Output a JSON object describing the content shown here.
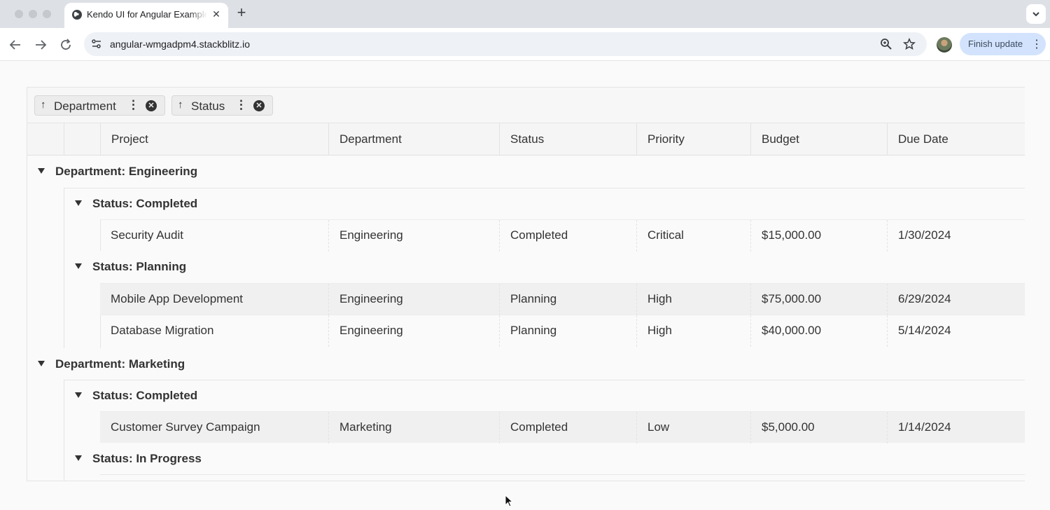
{
  "browser": {
    "tab_title": "Kendo UI for Angular Example",
    "tab_close": "✕",
    "new_tab": "+",
    "url": "angular-wmgadpm4.stackblitz.io",
    "update_button": "Finish update",
    "icons": [
      "globe-icon",
      "back-icon",
      "forward-icon",
      "reload-icon",
      "site-info-icon",
      "zoom-icon",
      "star-icon",
      "kebab-icon"
    ]
  },
  "grid": {
    "group_chips": [
      {
        "label": "Department",
        "arrow": "↑",
        "more": "⋮",
        "remove": "✕"
      },
      {
        "label": "Status",
        "arrow": "↑",
        "more": "⋮",
        "remove": "✕"
      }
    ],
    "columns": [
      "Project",
      "Department",
      "Status",
      "Priority",
      "Budget",
      "Due Date"
    ],
    "groups": [
      {
        "label": "Department: Engineering",
        "subgroups": [
          {
            "label": "Status: Completed",
            "rows": [
              [
                "Security Audit",
                "Engineering",
                "Completed",
                "Critical",
                "$15,000.00",
                "1/30/2024"
              ]
            ]
          },
          {
            "label": "Status: Planning",
            "rows": [
              [
                "Mobile App Development",
                "Engineering",
                "Planning",
                "High",
                "$75,000.00",
                "6/29/2024"
              ],
              [
                "Database Migration",
                "Engineering",
                "Planning",
                "High",
                "$40,000.00",
                "5/14/2024"
              ]
            ]
          }
        ]
      },
      {
        "label": "Department: Marketing",
        "subgroups": [
          {
            "label": "Status: Completed",
            "rows": [
              [
                "Customer Survey Campaign",
                "Marketing",
                "Completed",
                "Low",
                "$5,000.00",
                "1/14/2024"
              ]
            ]
          },
          {
            "label": "Status: In Progress",
            "rows": []
          }
        ]
      }
    ]
  }
}
